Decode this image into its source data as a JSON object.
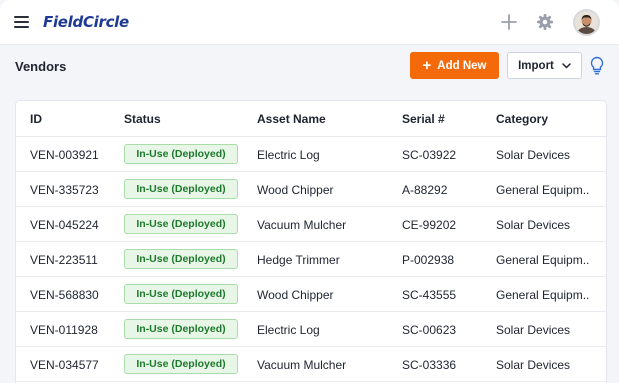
{
  "app": {
    "logo": "FieldCircle"
  },
  "header": {
    "page_title": "Vendors",
    "add_button_label": "Add New",
    "add_button_plus": "+",
    "import_button_label": "Import"
  },
  "colors": {
    "accent_orange": "#f46a0a",
    "brand_blue": "#1f3a93",
    "status_green_bg": "#e7f6e7",
    "status_green_text": "#1d7a2b"
  },
  "icons": {
    "menu": "hamburger-icon",
    "add": "plus-icon",
    "settings": "gear-icon",
    "import_dropdown": "chevron-down-icon",
    "help": "lightbulb-icon",
    "user": "avatar"
  },
  "table": {
    "columns": [
      "ID",
      "Status",
      "Asset Name",
      "Serial #",
      "Category"
    ],
    "rows": [
      {
        "id": "VEN-003921",
        "status": "In-Use (Deployed)",
        "asset": "Electric Log",
        "serial": "SC-03922",
        "category": "Solar Devices"
      },
      {
        "id": "VEN-335723",
        "status": "In-Use (Deployed)",
        "asset": "Wood Chipper",
        "serial": "A-88292",
        "category": "General Equipm.."
      },
      {
        "id": "VEN-045224",
        "status": "In-Use (Deployed)",
        "asset": "Vacuum Mulcher",
        "serial": "CE-99202",
        "category": "Solar Devices"
      },
      {
        "id": "VEN-223511",
        "status": "In-Use (Deployed)",
        "asset": "Hedge Trimmer",
        "serial": "P-002938",
        "category": "General Equipm.."
      },
      {
        "id": "VEN-568830",
        "status": "In-Use (Deployed)",
        "asset": "Wood Chipper",
        "serial": "SC-43555",
        "category": "General Equipm.."
      },
      {
        "id": "VEN-011928",
        "status": "In-Use (Deployed)",
        "asset": "Electric Log",
        "serial": "SC-00623",
        "category": "Solar Devices"
      },
      {
        "id": "VEN-034577",
        "status": "In-Use (Deployed)",
        "asset": "Vacuum Mulcher",
        "serial": "SC-03336",
        "category": "Solar Devices"
      }
    ]
  }
}
